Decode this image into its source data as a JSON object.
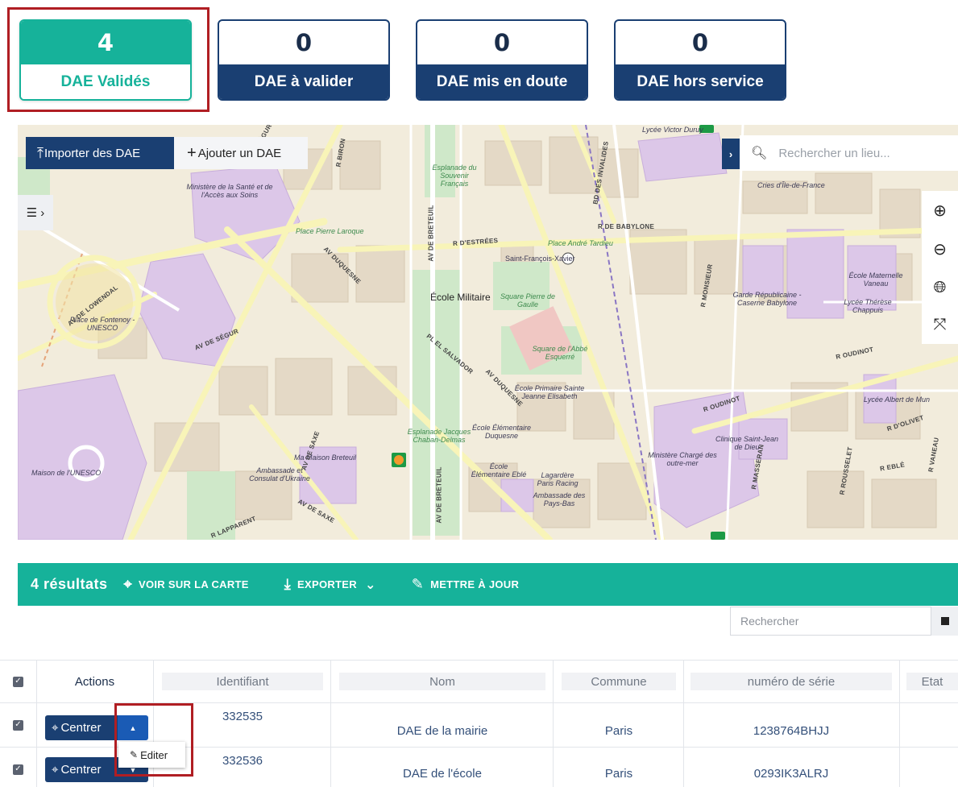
{
  "stats": [
    {
      "count": "4",
      "label": "DAE Validés"
    },
    {
      "count": "0",
      "label": "DAE à valider"
    },
    {
      "count": "0",
      "label": "DAE mis en doute"
    },
    {
      "count": "0",
      "label": "DAE hors service"
    }
  ],
  "map": {
    "import_label": "Importer des DAE",
    "add_label": "Ajouter un DAE",
    "search_placeholder": "Rechercher un lieu...",
    "labels": {
      "ecole_militaire": "École Militaire",
      "ministere_sante": "Ministère de la Santé et de l'Accès aux Soins",
      "place_fontenoy": "Place de Fontenoy - UNESCO",
      "maison_unesco": "Maison de l'UNESCO",
      "esplanade_souvenir": "Esplanade du Souvenir Français",
      "place_pierre_laroque": "Place Pierre Laroque",
      "place_andre_tardieu": "Place André Tardieu",
      "saint_francois_xavier": "Saint-François-Xavier",
      "square_pierre_gaulle": "Square Pierre de Gaulle",
      "square_abbe_esquerre": "Square de l'Abbé Esquerré",
      "ecole_primaire": "École Primaire Sainte Jeanne Elisabeth",
      "ecole_duquesne": "École Élémentaire Duquesne",
      "ecole_eble": "École Élémentaire Eblé",
      "esplanade_chaban": "Esplanade Jacques Chaban-Delmas",
      "maison_breteuil": "Ma Maison Breteuil",
      "ambassade_ukraine": "Ambassade et Consulat d'Ukraine",
      "lagardere": "Lagardère Paris Racing",
      "ambassade_pays_bas": "Ambassade des Pays-Bas",
      "lycee_duruy": "Lycée Victor Duruy",
      "cries_idf": "Cries d'Île-de-France",
      "ecole_vaneau": "École Maternelle Vaneau",
      "garde_republicaine": "Garde Républicaine - Caserne Babylone",
      "lycee_chappuis": "Lycée Thérèse Chappuis",
      "lycee_albert": "Lycée Albert de Mun",
      "clinique": "Clinique Saint-Jean de Dieu",
      "ministere_outremer": "Ministère Chargé des outre-mer",
      "r_babylone": "R DE BABYLONE",
      "r_estrees": "R D'ESTRÉES",
      "r_oudinot": "R OUDINOT",
      "r_olivet": "R D'OLIVET",
      "av_lowendal": "AV DE LOWENDAL",
      "av_duquesne": "AV DUQUESNE",
      "av_breteuil": "AV DE BRETEUIL",
      "av_segur": "AV DE SÉGUR",
      "av_saxe": "AV DE SAXE",
      "bd_invalides": "BD DES INVALIDES",
      "pl_salvador": "PL EL SALVADOR",
      "r_monsieur": "R MONSIEUR",
      "r_rousselet": "R ROUSSELET",
      "r_vaneau": "R VANEAU",
      "r_lapparent": "R LAPPARENT",
      "r_masseran": "R MASSERAN",
      "r_eblé": "R EBLÉ",
      "r_biron": "R BIRON"
    }
  },
  "results": {
    "count_label": "4 résultats",
    "see_on_map": "VOIR SUR LA CARTE",
    "export": "EXPORTER",
    "update": "METTRE À JOUR",
    "search_placeholder": "Rechercher"
  },
  "table": {
    "headers": {
      "actions": "Actions",
      "identifiant": "Identifiant",
      "nom": "Nom",
      "commune": "Commune",
      "numero_serie": "numéro de série",
      "etat": "Etat"
    },
    "center_label": "Centrer",
    "edit_label": "Editer",
    "rows": [
      {
        "identifiant": "332535",
        "nom": "DAE de la mairie",
        "commune": "Paris",
        "numero_serie": "1238764BHJJ",
        "etat": ""
      },
      {
        "identifiant": "332536",
        "nom": "DAE de l'école",
        "commune": "Paris",
        "numero_serie": "0293IK3ALRJ",
        "etat": ""
      }
    ]
  },
  "colors": {
    "accent_green": "#16b29a",
    "primary_navy": "#1a3f72",
    "highlight_red": "#b01e23",
    "caret_blue": "#1a5bb5"
  }
}
